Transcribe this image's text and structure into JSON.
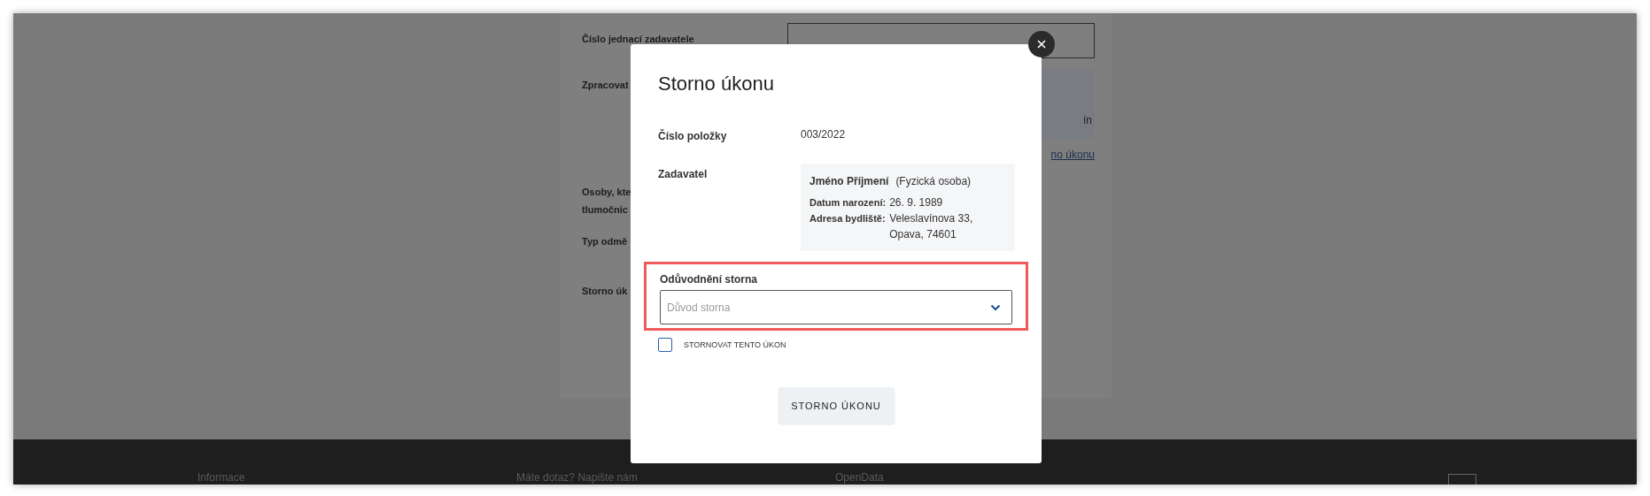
{
  "background": {
    "rows": [
      {
        "kind": "input",
        "label": "Číslo jednací zadavatele"
      },
      {
        "kind": "box",
        "label": "Zpracovat",
        "value": "ín"
      },
      {
        "kind": "link",
        "value": "no úkonu"
      },
      {
        "kind": "text",
        "label": "Osoby, kte\ntlumočnic"
      },
      {
        "kind": "text",
        "label": "Typ odmě"
      },
      {
        "kind": "text",
        "label": "Storno úk"
      }
    ],
    "footer": [
      "Informace",
      "Máte dotaz? Napište nám",
      "OpenData"
    ]
  },
  "modal": {
    "title": "Storno úkonu",
    "item_number": {
      "label": "Číslo položky",
      "value": "003/2022"
    },
    "requester": {
      "label": "Zadavatel",
      "name": "Jméno Příjmení",
      "type": "(Fyzická osoba)",
      "details": [
        {
          "label": "Datum narození:",
          "value": "26. 9. 1989"
        },
        {
          "label": "Adresa bydliště:",
          "value": "Veleslavínova 33, Opava, 74601"
        }
      ]
    },
    "reason": {
      "label": "Odůvodnění storna",
      "placeholder": "Důvod storna",
      "highlighted": true
    },
    "confirm": {
      "label": "STORNOVAT TENTO ÚKON",
      "checked": false
    },
    "button": "STORNO ÚKONU"
  }
}
